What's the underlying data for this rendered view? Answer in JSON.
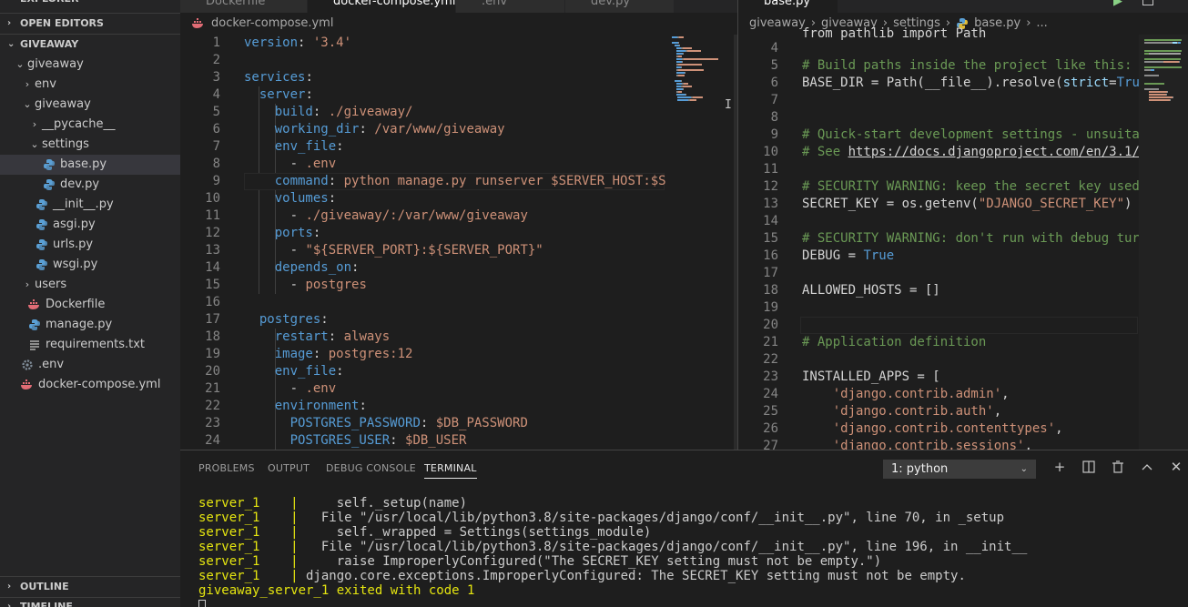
{
  "sidebar": {
    "explorer_title": "EXPLORER",
    "open_editors": "OPEN EDITORS",
    "project": "GIVEAWAY",
    "tree": [
      {
        "label": "giveaway",
        "depth": 0,
        "kind": "folder-open"
      },
      {
        "label": "env",
        "depth": 1,
        "kind": "folder-closed"
      },
      {
        "label": "giveaway",
        "depth": 1,
        "kind": "folder-open"
      },
      {
        "label": "__pycache__",
        "depth": 2,
        "kind": "folder-closed"
      },
      {
        "label": "settings",
        "depth": 2,
        "kind": "folder-open"
      },
      {
        "label": "base.py",
        "depth": 3,
        "kind": "python",
        "selected": true
      },
      {
        "label": "dev.py",
        "depth": 3,
        "kind": "python"
      },
      {
        "label": "__init__.py",
        "depth": 2,
        "kind": "python"
      },
      {
        "label": "asgi.py",
        "depth": 2,
        "kind": "python"
      },
      {
        "label": "urls.py",
        "depth": 2,
        "kind": "python"
      },
      {
        "label": "wsgi.py",
        "depth": 2,
        "kind": "python"
      },
      {
        "label": "users",
        "depth": 1,
        "kind": "folder-closed"
      },
      {
        "label": "Dockerfile",
        "depth": 1,
        "kind": "docker"
      },
      {
        "label": "manage.py",
        "depth": 1,
        "kind": "python"
      },
      {
        "label": "requirements.txt",
        "depth": 1,
        "kind": "text"
      },
      {
        "label": ".env",
        "depth": 0,
        "kind": "gear"
      },
      {
        "label": "docker-compose.yml",
        "depth": 0,
        "kind": "docker"
      }
    ],
    "outline": "OUTLINE",
    "timeline": "TIMELINE"
  },
  "left_editor": {
    "tabs": [
      "Dockerfile",
      "docker-compose.yml",
      ".env",
      "dev.py"
    ],
    "active_tab": "docker-compose.yml",
    "breadcrumb": "docker-compose.yml",
    "lines": [
      {
        "n": "1",
        "parts": [
          [
            "key",
            "version"
          ],
          [
            "plain",
            ": "
          ],
          [
            "str",
            "'3.4'"
          ]
        ]
      },
      {
        "n": "2",
        "parts": []
      },
      {
        "n": "3",
        "parts": [
          [
            "key",
            "services"
          ],
          [
            "plain",
            ":"
          ]
        ]
      },
      {
        "n": "4",
        "parts": [
          [
            "plain",
            "  "
          ],
          [
            "key",
            "server"
          ],
          [
            "plain",
            ":"
          ]
        ]
      },
      {
        "n": "5",
        "parts": [
          [
            "plain",
            "    "
          ],
          [
            "key",
            "build"
          ],
          [
            "plain",
            ": "
          ],
          [
            "str",
            "./giveaway/"
          ]
        ]
      },
      {
        "n": "6",
        "parts": [
          [
            "plain",
            "    "
          ],
          [
            "key",
            "working_dir"
          ],
          [
            "plain",
            ": "
          ],
          [
            "str",
            "/var/www/giveaway"
          ]
        ]
      },
      {
        "n": "7",
        "parts": [
          [
            "plain",
            "    "
          ],
          [
            "key",
            "env_file"
          ],
          [
            "plain",
            ":"
          ]
        ]
      },
      {
        "n": "8",
        "parts": [
          [
            "plain",
            "      - "
          ],
          [
            "str",
            ".env"
          ]
        ]
      },
      {
        "n": "9",
        "parts": [
          [
            "plain",
            "    "
          ],
          [
            "key",
            "command"
          ],
          [
            "plain",
            ": "
          ],
          [
            "str",
            "python manage.py runserver $SERVER_HOST:$S"
          ]
        ]
      },
      {
        "n": "10",
        "parts": [
          [
            "plain",
            "    "
          ],
          [
            "key",
            "volumes"
          ],
          [
            "plain",
            ":"
          ]
        ]
      },
      {
        "n": "11",
        "parts": [
          [
            "plain",
            "      - "
          ],
          [
            "str",
            "./giveaway/:/var/www/giveaway"
          ]
        ]
      },
      {
        "n": "12",
        "parts": [
          [
            "plain",
            "    "
          ],
          [
            "key",
            "ports"
          ],
          [
            "plain",
            ":"
          ]
        ]
      },
      {
        "n": "13",
        "parts": [
          [
            "plain",
            "      - "
          ],
          [
            "str",
            "\"${SERVER_PORT}:${SERVER_PORT}\""
          ]
        ]
      },
      {
        "n": "14",
        "parts": [
          [
            "plain",
            "    "
          ],
          [
            "key",
            "depends_on"
          ],
          [
            "plain",
            ":"
          ]
        ]
      },
      {
        "n": "15",
        "parts": [
          [
            "plain",
            "      - "
          ],
          [
            "str",
            "postgres"
          ]
        ]
      },
      {
        "n": "16",
        "parts": []
      },
      {
        "n": "17",
        "parts": [
          [
            "plain",
            "  "
          ],
          [
            "key",
            "postgres"
          ],
          [
            "plain",
            ":"
          ]
        ]
      },
      {
        "n": "18",
        "parts": [
          [
            "plain",
            "    "
          ],
          [
            "key",
            "restart"
          ],
          [
            "plain",
            ": "
          ],
          [
            "str",
            "always"
          ]
        ]
      },
      {
        "n": "19",
        "parts": [
          [
            "plain",
            "    "
          ],
          [
            "key",
            "image"
          ],
          [
            "plain",
            ": "
          ],
          [
            "str",
            "postgres:12"
          ]
        ]
      },
      {
        "n": "20",
        "parts": [
          [
            "plain",
            "    "
          ],
          [
            "key",
            "env_file"
          ],
          [
            "plain",
            ":"
          ]
        ]
      },
      {
        "n": "21",
        "parts": [
          [
            "plain",
            "      - "
          ],
          [
            "str",
            ".env"
          ]
        ]
      },
      {
        "n": "22",
        "parts": [
          [
            "plain",
            "    "
          ],
          [
            "key",
            "environment"
          ],
          [
            "plain",
            ":"
          ]
        ]
      },
      {
        "n": "23",
        "parts": [
          [
            "plain",
            "      "
          ],
          [
            "key",
            "POSTGRES_PASSWORD"
          ],
          [
            "plain",
            ": "
          ],
          [
            "str",
            "$DB_PASSWORD"
          ]
        ]
      },
      {
        "n": "24",
        "parts": [
          [
            "plain",
            "      "
          ],
          [
            "key",
            "POSTGRES_USER"
          ],
          [
            "plain",
            ": "
          ],
          [
            "str",
            "$DB_USER"
          ]
        ]
      }
    ]
  },
  "right_editor": {
    "active_tab": "base.py",
    "breadcrumb": [
      "giveaway",
      "giveaway",
      "settings",
      "base.py",
      "..."
    ],
    "top_partial": "from pathlib import Path",
    "lines": [
      {
        "n": "4",
        "parts": []
      },
      {
        "n": "5",
        "parts": [
          [
            "com",
            "# Build paths inside the project like this: B"
          ]
        ]
      },
      {
        "n": "6",
        "parts": [
          [
            "plain",
            "BASE_DIR = Path(__file__).resolve("
          ],
          [
            "var",
            "strict"
          ],
          [
            "plain",
            "="
          ],
          [
            "kw",
            "Tru"
          ]
        ]
      },
      {
        "n": "7",
        "parts": []
      },
      {
        "n": "8",
        "parts": []
      },
      {
        "n": "9",
        "parts": [
          [
            "com",
            "# Quick-start development settings - unsuitab"
          ]
        ]
      },
      {
        "n": "10",
        "parts": [
          [
            "com",
            "# See "
          ],
          [
            "link",
            "https://docs.djangoproject.com/en/3.1/h"
          ]
        ]
      },
      {
        "n": "11",
        "parts": []
      },
      {
        "n": "12",
        "parts": [
          [
            "com",
            "# SECURITY WARNING: keep the secret key used"
          ]
        ]
      },
      {
        "n": "13",
        "parts": [
          [
            "plain",
            "SECRET_KEY = os.getenv("
          ],
          [
            "str",
            "\"DJANGO_SECRET_KEY\""
          ],
          [
            "plain",
            ")"
          ]
        ]
      },
      {
        "n": "14",
        "parts": []
      },
      {
        "n": "15",
        "parts": [
          [
            "com",
            "# SECURITY WARNING: don't run with debug turn"
          ]
        ]
      },
      {
        "n": "16",
        "parts": [
          [
            "plain",
            "DEBUG = "
          ],
          [
            "kw",
            "True"
          ]
        ]
      },
      {
        "n": "17",
        "parts": []
      },
      {
        "n": "18",
        "parts": [
          [
            "plain",
            "ALLOWED_HOSTS = []"
          ]
        ]
      },
      {
        "n": "19",
        "parts": []
      },
      {
        "n": "20",
        "parts": []
      },
      {
        "n": "21",
        "parts": [
          [
            "com",
            "# Application definition"
          ]
        ]
      },
      {
        "n": "22",
        "parts": []
      },
      {
        "n": "23",
        "parts": [
          [
            "plain",
            "INSTALLED_APPS = ["
          ]
        ]
      },
      {
        "n": "24",
        "parts": [
          [
            "plain",
            "    "
          ],
          [
            "str",
            "'django.contrib.admin'"
          ],
          [
            "plain",
            ","
          ]
        ]
      },
      {
        "n": "25",
        "parts": [
          [
            "plain",
            "    "
          ],
          [
            "str",
            "'django.contrib.auth'"
          ],
          [
            "plain",
            ","
          ]
        ]
      },
      {
        "n": "26",
        "parts": [
          [
            "plain",
            "    "
          ],
          [
            "str",
            "'django.contrib.contenttypes'"
          ],
          [
            "plain",
            ","
          ]
        ]
      },
      {
        "n": "27",
        "parts": [
          [
            "plain",
            "    "
          ],
          [
            "str",
            "'django.contrib.sessions'"
          ],
          [
            "plain",
            ","
          ]
        ]
      }
    ]
  },
  "panel": {
    "tabs": [
      "PROBLEMS",
      "OUTPUT",
      "DEBUG CONSOLE",
      "TERMINAL"
    ],
    "active_tab": "TERMINAL",
    "terminal_select": "1: python",
    "terminal_lines": [
      {
        "prefix": "server_1    |",
        "text": "     self._setup(name)"
      },
      {
        "prefix": "server_1    |",
        "text": "   File \"/usr/local/lib/python3.8/site-packages/django/conf/__init__.py\", line 70, in _setup"
      },
      {
        "prefix": "server_1    |",
        "text": "     self._wrapped = Settings(settings_module)"
      },
      {
        "prefix": "server_1    |",
        "text": "   File \"/usr/local/lib/python3.8/site-packages/django/conf/__init__.py\", line 196, in __init__"
      },
      {
        "prefix": "server_1    |",
        "text": "     raise ImproperlyConfigured(\"The SECRET_KEY setting must not be empty.\")"
      },
      {
        "prefix": "server_1    |",
        "text": " django.core.exceptions.ImproperlyConfigured: The SECRET_KEY setting must not be empty."
      }
    ],
    "exit_line": "giveaway_server_1 exited with code 1"
  },
  "colors": {
    "yaml_key": "#569cd6",
    "string": "#ce9178",
    "comment": "#6a9955",
    "terminal_yellow": "#e5e510"
  }
}
